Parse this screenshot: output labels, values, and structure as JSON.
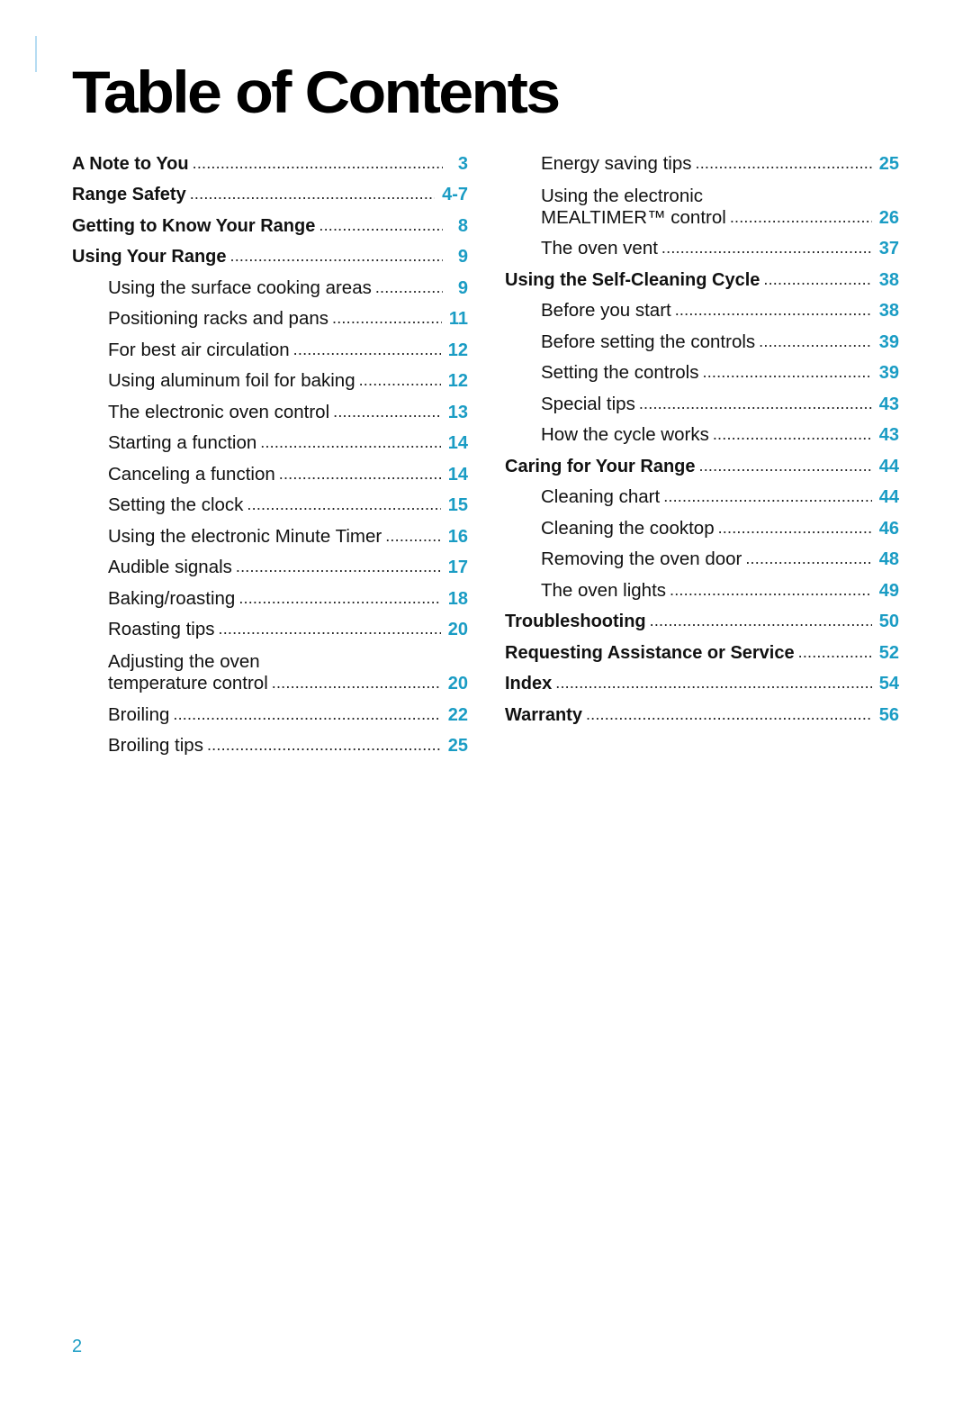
{
  "document": {
    "title": "Table of Contents",
    "page_number": "2",
    "accent_color": "#1a9cc4"
  },
  "toc": {
    "left": [
      {
        "label": "A Note to You",
        "page": "3",
        "level": "main"
      },
      {
        "label": "Range Safety",
        "page": "4-7",
        "level": "main"
      },
      {
        "label": "Getting to Know Your Range",
        "page": "8",
        "level": "main"
      },
      {
        "label": "Using Your Range",
        "page": "9",
        "level": "main"
      },
      {
        "label": "Using the surface cooking areas",
        "page": "9",
        "level": "sub"
      },
      {
        "label": "Positioning racks and pans",
        "page": "11",
        "level": "sub"
      },
      {
        "label": "For best air circulation",
        "page": "12",
        "level": "sub"
      },
      {
        "label": "Using aluminum foil for baking",
        "page": "12",
        "level": "sub"
      },
      {
        "label": "The electronic oven control",
        "page": "13",
        "level": "sub"
      },
      {
        "label": "Starting a function",
        "page": "14",
        "level": "sub"
      },
      {
        "label": "Canceling a function",
        "page": "14",
        "level": "sub"
      },
      {
        "label": "Setting the clock",
        "page": "15",
        "level": "sub"
      },
      {
        "label": "Using the electronic Minute Timer",
        "page": "16",
        "level": "sub"
      },
      {
        "label": "Audible signals",
        "page": "17",
        "level": "sub"
      },
      {
        "label": "Baking/roasting",
        "page": "18",
        "level": "sub"
      },
      {
        "label": "Roasting tips",
        "page": "20",
        "level": "sub"
      },
      {
        "label_line1": "Adjusting the oven",
        "label_line2": "temperature control",
        "page": "20",
        "level": "sub"
      },
      {
        "label": "Broiling",
        "page": "22",
        "level": "sub"
      },
      {
        "label": "Broiling tips",
        "page": "25",
        "level": "sub"
      }
    ],
    "right": [
      {
        "label": "Energy saving tips",
        "page": "25",
        "level": "sub"
      },
      {
        "label_line1": "Using the electronic",
        "label_line2": "MEALTIMER™ control",
        "page": "26",
        "level": "sub"
      },
      {
        "label": "The oven vent",
        "page": "37",
        "level": "sub"
      },
      {
        "label": "Using the Self-Cleaning Cycle",
        "page": "38",
        "level": "main"
      },
      {
        "label": "Before you start",
        "page": "38",
        "level": "sub"
      },
      {
        "label": "Before setting the controls",
        "page": "39",
        "level": "sub"
      },
      {
        "label": "Setting the controls",
        "page": "39",
        "level": "sub"
      },
      {
        "label": "Special tips",
        "page": "43",
        "level": "sub"
      },
      {
        "label": "How the cycle works",
        "page": "43",
        "level": "sub"
      },
      {
        "label": "Caring for Your Range",
        "page": "44",
        "level": "main"
      },
      {
        "label": "Cleaning chart",
        "page": "44",
        "level": "sub"
      },
      {
        "label": "Cleaning the cooktop",
        "page": "46",
        "level": "sub"
      },
      {
        "label": "Removing the oven door",
        "page": "48",
        "level": "sub"
      },
      {
        "label": "The oven lights",
        "page": "49",
        "level": "sub"
      },
      {
        "label": "Troubleshooting",
        "page": "50",
        "level": "main"
      },
      {
        "label": "Requesting Assistance or Service",
        "page": "52",
        "level": "main"
      },
      {
        "label": "Index",
        "page": "54",
        "level": "main"
      },
      {
        "label": "Warranty",
        "page": "56",
        "level": "main"
      }
    ]
  }
}
